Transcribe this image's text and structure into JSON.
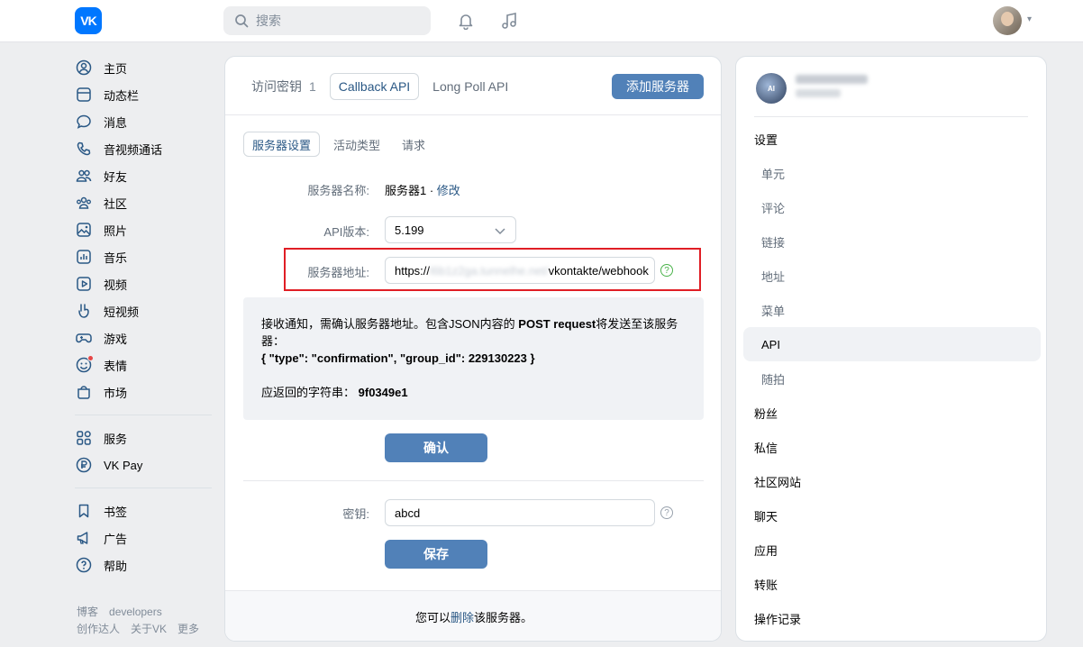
{
  "header": {
    "logo_text": "VK",
    "search_placeholder": "搜索"
  },
  "leftnav": {
    "items": [
      {
        "label": "主页",
        "icon": "user-circle-icon"
      },
      {
        "label": "动态栏",
        "icon": "newsfeed-icon"
      },
      {
        "label": "消息",
        "icon": "message-icon"
      },
      {
        "label": "音视频通话",
        "icon": "phone-icon"
      },
      {
        "label": "好友",
        "icon": "friends-icon"
      },
      {
        "label": "社区",
        "icon": "community-icon"
      },
      {
        "label": "照片",
        "icon": "photo-icon"
      },
      {
        "label": "音乐",
        "icon": "music-icon"
      },
      {
        "label": "视频",
        "icon": "video-icon"
      },
      {
        "label": "短视频",
        "icon": "clips-icon"
      },
      {
        "label": "游戏",
        "icon": "gamepad-icon"
      },
      {
        "label": "表情",
        "icon": "smile-icon"
      },
      {
        "label": "市场",
        "icon": "market-icon"
      }
    ],
    "items2": [
      {
        "label": "服务",
        "icon": "services-icon"
      },
      {
        "label": "VK Pay",
        "icon": "vkpay-icon"
      }
    ],
    "items3": [
      {
        "label": "书签",
        "icon": "bookmark-icon"
      },
      {
        "label": "广告",
        "icon": "megaphone-icon"
      },
      {
        "label": "帮助",
        "icon": "help-icon"
      }
    ],
    "footer": {
      "blog": "博客",
      "developers": "developers",
      "creators": "创作达人",
      "about": "关于VK",
      "more": "更多"
    }
  },
  "main": {
    "tabs": [
      {
        "label": "访问密钥",
        "count": "1"
      },
      {
        "label": "Callback API"
      },
      {
        "label": "Long Poll API"
      }
    ],
    "add_server_label": "添加服务器",
    "subtabs": [
      "服务器设置",
      "活动类型",
      "请求"
    ],
    "server_name_label": "服务器名称:",
    "server_name_value": "服务器1",
    "edit_link": "修改",
    "api_version_label": "API版本:",
    "api_version_value": "5.199",
    "server_address_label": "服务器地址:",
    "server_address_prefix": "https://",
    "server_address_hidden": "l6b1z2ga.tunnelhe.net/",
    "server_address_suffix": "vkontakte/webhook",
    "info": {
      "line1_pre": "接收通知，需确认服务器地址。包含JSON内容的 ",
      "line1_bold": "POST request",
      "line1_post": "将发送至该服务器：",
      "json_line": "{ \"type\": \"confirmation\", \"group_id\": 229130223 }",
      "return_label": "应返回的字符串：",
      "return_value": "9f0349e1"
    },
    "confirm_label": "确认",
    "secret_label": "密钥:",
    "secret_value": "abcd",
    "save_label": "保存",
    "footer_pre": "您可以 ",
    "footer_link": "删除",
    "footer_post": "该服务器。"
  },
  "rpanel": {
    "avatar_text": "AI",
    "menu": [
      {
        "label": "设置",
        "type": "top"
      },
      {
        "label": "单元",
        "type": "sub"
      },
      {
        "label": "评论",
        "type": "sub"
      },
      {
        "label": "链接",
        "type": "sub"
      },
      {
        "label": "地址",
        "type": "sub"
      },
      {
        "label": "菜单",
        "type": "sub"
      },
      {
        "label": "API",
        "type": "sel"
      },
      {
        "label": "随拍",
        "type": "sub"
      },
      {
        "label": "粉丝",
        "type": "top"
      },
      {
        "label": "私信",
        "type": "top"
      },
      {
        "label": "社区网站",
        "type": "top"
      },
      {
        "label": "聊天",
        "type": "top"
      },
      {
        "label": "应用",
        "type": "top"
      },
      {
        "label": "转账",
        "type": "top"
      },
      {
        "label": "操作记录",
        "type": "top"
      }
    ]
  },
  "colors": {
    "accent": "#5181b8",
    "link": "#2a5885",
    "highlight": "#e01e25"
  }
}
